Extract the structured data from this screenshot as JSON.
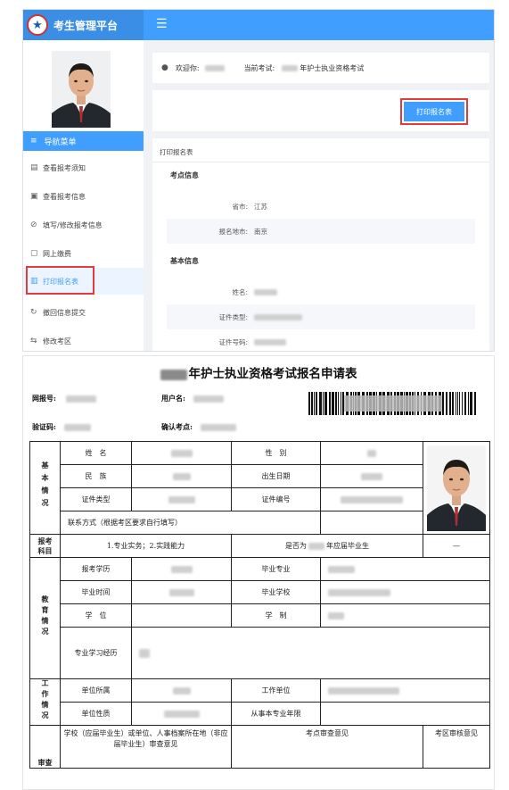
{
  "app": {
    "title": "考生管理平台",
    "logo_glyph": "★",
    "menu_toggle_glyph": "☰"
  },
  "sidebar": {
    "nav_header": {
      "icon": "≡",
      "label": "导航菜单"
    },
    "items": [
      {
        "icon": "▤",
        "label": "查看报考须知"
      },
      {
        "icon": "▣",
        "label": "查看报考信息"
      },
      {
        "icon": "⊘",
        "label": "填写/修改报考信息"
      },
      {
        "icon": "▢",
        "label": "网上缴费"
      },
      {
        "icon": "▥",
        "label": "打印报名表"
      },
      {
        "icon": "↻",
        "label": "撤回信息提交"
      },
      {
        "icon": "⇆",
        "label": "修改考区"
      }
    ],
    "active_index": 4
  },
  "welcome": {
    "user_icon": "👤",
    "greeting": "欢迎你:",
    "exam_label": "当前考试:",
    "exam_name": "年护士执业资格考试"
  },
  "print_button": "打印报名表",
  "form": {
    "title": "打印报名表",
    "sections": {
      "exam_site": "考点信息",
      "basic": "基本信息"
    },
    "fields": {
      "province_label": "省市:",
      "province_value": "江苏",
      "city_label": "报名地市:",
      "city_value": "南京",
      "name_label": "姓名:",
      "idtype_label": "证件类型:",
      "idno_label": "证件号码:"
    }
  },
  "document": {
    "title": "年护士执业资格考试报名申请表",
    "meta": {
      "web_no": "网报号:",
      "username": "用户名:",
      "verify_code": "验证码:",
      "confirm_site": "确认考点:"
    },
    "table": {
      "basic_head": "基本情况",
      "name": "姓　名",
      "gender": "性　别",
      "ethnic": "民　族",
      "birth": "出生日期",
      "id_type": "证件类型",
      "id_no": "证件编号",
      "contact": "联系方式（根据考区要求自行填写）",
      "subject_head": "报考科目",
      "subjects": "1.专业实务；2.实践能力",
      "is_grad": "是否为",
      "grad_suffix": "年应届毕业生",
      "edu_head": "教育情况",
      "edu_level": "报考学历",
      "major": "毕业专业",
      "grad_time": "毕业时间",
      "school": "毕业学校",
      "degree": "学　位",
      "system": "学　制",
      "study_history": "专业学习经历",
      "work_head": "工作情况",
      "employer": "单位所属",
      "work_unit": "工作单位",
      "unit_type": "单位性质",
      "years": "从事本专业年限",
      "review_head": "审查",
      "school_review": "学校（应届毕业生）或单位、人事档案所在地（非应届毕业生）审查意见",
      "site_review": "考点审查意见",
      "area_review": "考区审核意见"
    }
  },
  "colors": {
    "primary": "#409eff",
    "header_blue": "#3a8ee6",
    "highlight_red": "#e23b3b",
    "active_bg": "#ecf5ff"
  }
}
